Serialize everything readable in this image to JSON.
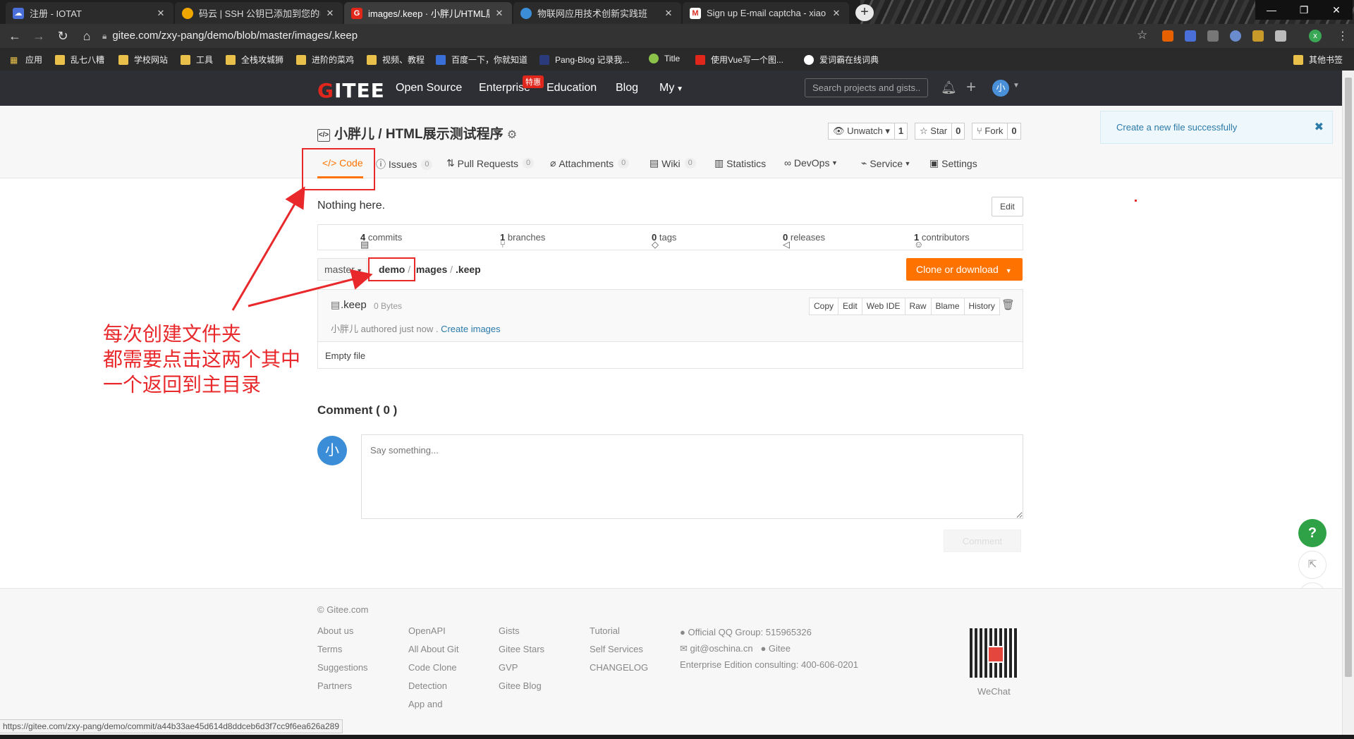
{
  "browser": {
    "tabs": [
      {
        "title": "注册 - IOTAT",
        "icon_color": "#4a6fd8"
      },
      {
        "title": "码云 | SSH 公钥已添加到您的帐",
        "icon_color": "#f0a800"
      },
      {
        "title": "images/.keep · 小胖儿/HTML展",
        "icon_color": "#e1261c",
        "active": true
      },
      {
        "title": "物联网应用技术创新实践班",
        "icon_color": "#3a8dd6"
      },
      {
        "title": "Sign up E-mail captcha - xiao",
        "icon_color": "#d93025"
      }
    ],
    "url": "gitee.com/zxy-pang/demo/blob/master/images/.keep",
    "bookmarks": [
      "应用",
      "乱七八糟",
      "学校网站",
      "工具",
      "全栈攻城狮",
      "进阶的菜鸡",
      "视频、教程",
      "百度一下，你就知道",
      "Pang-Blog 记录我...",
      "Title",
      "使用Vue写一个图...",
      "爱词霸在线词典"
    ],
    "other_bookmarks": "其他书签",
    "profile_initial": "x"
  },
  "gitee": {
    "logo": "GITEE",
    "nav": [
      "Open Source",
      "Enterprise",
      "Education",
      "Blog",
      "My"
    ],
    "enterprise_badge": "特惠",
    "search_placeholder": "Search projects and gists..",
    "avatar": "小"
  },
  "project": {
    "title": "小胖儿 / HTML展示测试程序",
    "watch": {
      "label": "Unwatch",
      "count": "1"
    },
    "star": {
      "label": "Star",
      "count": "0"
    },
    "fork": {
      "label": "Fork",
      "count": "0"
    },
    "tabs": [
      {
        "label": "Code"
      },
      {
        "label": "Issues",
        "count": "0"
      },
      {
        "label": "Pull Requests",
        "count": "0"
      },
      {
        "label": "Attachments",
        "count": "0"
      },
      {
        "label": "Wiki",
        "count": "0"
      },
      {
        "label": "Statistics"
      },
      {
        "label": "DevOps"
      },
      {
        "label": "Service"
      },
      {
        "label": "Settings"
      }
    ]
  },
  "toast": "Create a new file successfully",
  "repo": {
    "readme": "Nothing here.",
    "edit": "Edit",
    "stats": {
      "commits": {
        "n": "4",
        "label": "commits"
      },
      "branches": {
        "n": "1",
        "label": "branches"
      },
      "tags": {
        "n": "0",
        "label": "tags"
      },
      "releases": {
        "n": "0",
        "label": "releases"
      },
      "contributors": {
        "n": "1",
        "label": "contributors"
      }
    },
    "branch": "master",
    "crumbs": [
      "demo",
      "images",
      ".keep"
    ],
    "clone": "Clone or download"
  },
  "file": {
    "name": ".keep",
    "size": "0 Bytes",
    "author_meta": "小胖儿 authored just now .",
    "commit_msg": "Create images",
    "buttons": [
      "Copy",
      "Edit",
      "Web IDE",
      "Raw",
      "Blame",
      "History"
    ],
    "content": "Empty file"
  },
  "comment": {
    "heading": "Comment ( 0 )",
    "avatar": "小",
    "placeholder": "Say something...",
    "submit": "Comment"
  },
  "footer": {
    "copyright": "© Gitee.com",
    "col1": [
      "About us",
      "Terms",
      "Suggestions",
      "Partners"
    ],
    "col2": [
      "OpenAPI",
      "All About Git",
      "Code Clone",
      "Detection",
      "App and"
    ],
    "col3": [
      "Gists",
      "Gitee Stars",
      "GVP",
      "Gitee Blog"
    ],
    "col4": [
      "Tutorial",
      "Self Services",
      "CHANGELOG"
    ],
    "qq": "Official QQ Group: 515965326",
    "email": "git@oschina.cn",
    "gitee_label": "Gitee",
    "enterprise": "Enterprise Edition consulting: 400-606-0201",
    "wechat": "WeChat"
  },
  "status_url": "https://gitee.com/zxy-pang/demo/commit/a44b33ae45d614d8ddceb6d3f7cc9f6ea626a289",
  "annotation": [
    "每次创建文件夹",
    "都需要点击这两个其中",
    "一个返回到主目录"
  ],
  "colors": {
    "accent": "#fe7300",
    "header_bg": "#2e2f34",
    "annotation": "#e8282b",
    "brand_red": "#e1261c",
    "help_green": "#2fa247"
  }
}
